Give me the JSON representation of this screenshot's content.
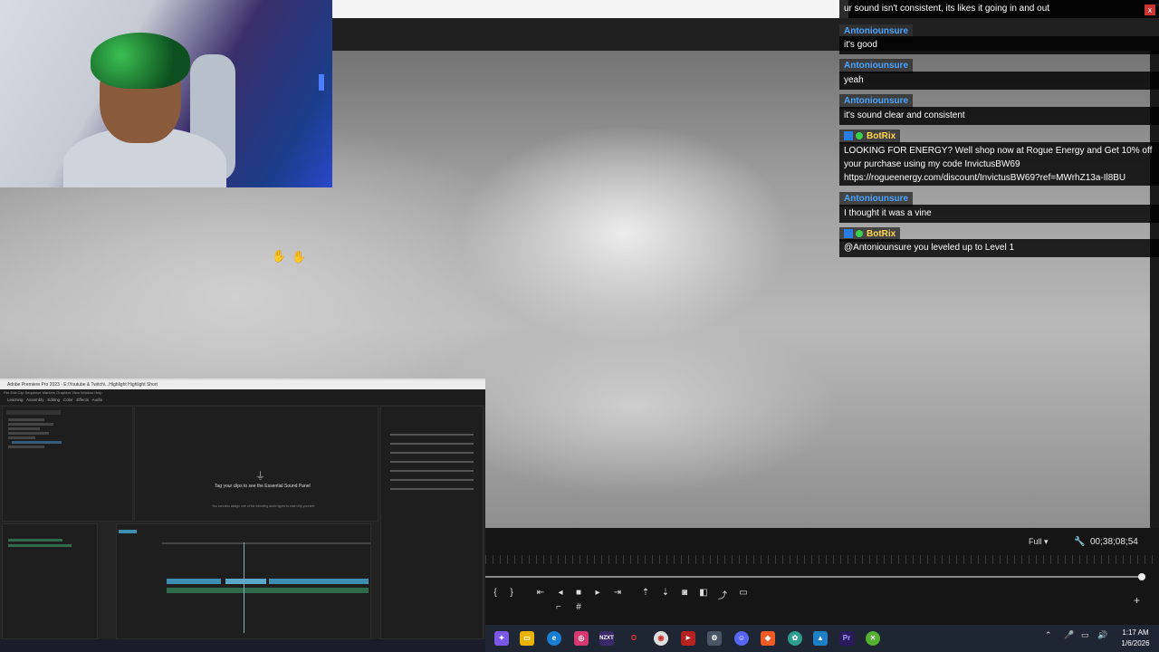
{
  "chat": {
    "top_line": "ur sound isn't consistent, its likes it going in and out",
    "close_label": "x",
    "messages": [
      {
        "user": "Antoniounsure",
        "text": "it's good"
      },
      {
        "user": "Antoniounsure",
        "text": "yeah"
      },
      {
        "user": "Antoniounsure",
        "text": "it's sound clear and consistent"
      },
      {
        "user": "BotRix",
        "text": "LOOKING FOR ENERGY? Well shop now at Rogue Energy and Get 10% off your purchase using my code InvictusBW69 https://rogueenergy.com/discount/InvictusBW69?ref=MWrhZ13a-Il8BU"
      },
      {
        "user": "Antoniounsure",
        "text": "I thought it was a vine"
      },
      {
        "user": "BotRix",
        "text": "@Antoniounsure you leveled up to Level 1"
      }
    ]
  },
  "player": {
    "resolution": "Full",
    "timecode": "00;38;08;54",
    "playhead": 0.995
  },
  "premiere": {
    "title": "Adobe Premiere Pro 2023 - E:\\Youtube & Twitch\\...Highlight Highlight Short",
    "workspace_tabs": [
      "Learning",
      "Assembly",
      "Editing",
      "Color",
      "Effects",
      "Audio"
    ],
    "essential_sound_title": "Tag your clips to see the Essential Sound Panel",
    "essential_sound_sub": "You can also assign one of the following audio types to each clip yourself:"
  },
  "taskbar": {
    "time": "1:17 AM",
    "date": "1/6/2026",
    "icons": [
      "copilot",
      "files",
      "edge",
      "instagram",
      "nzxt",
      "opera",
      "chrome",
      "stream",
      "settings",
      "discord",
      "brave",
      "photos",
      "premiere",
      "xbox"
    ]
  },
  "colors": {
    "chat_name": "#4aa3ff",
    "chat_bot": "#ffd84a",
    "accent": "#2a7de1"
  }
}
